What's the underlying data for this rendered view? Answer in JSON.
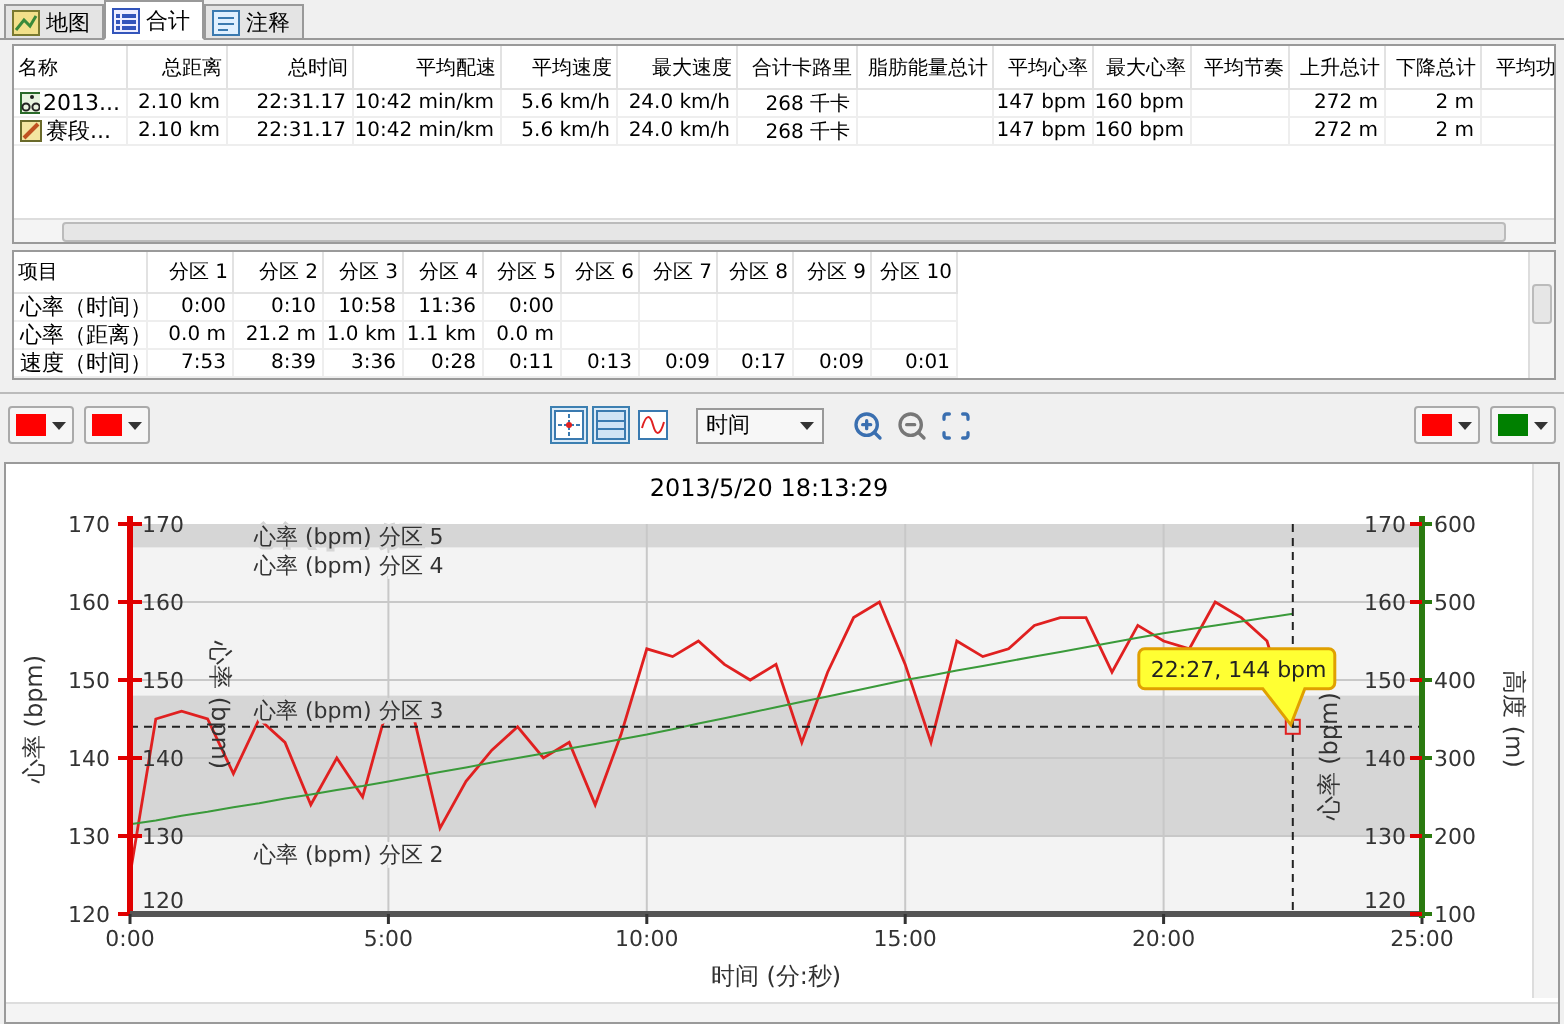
{
  "tabs": [
    {
      "label": "地图",
      "kind": "map",
      "selected": false
    },
    {
      "label": "合计",
      "kind": "grid",
      "selected": true
    },
    {
      "label": "注释",
      "kind": "note",
      "selected": false
    }
  ],
  "summary": {
    "columns": [
      "名称",
      "总距离",
      "总时间",
      "平均配速",
      "平均速度",
      "最大速度",
      "合计卡路里",
      "脂肪能量总计",
      "平均心率",
      "最大心率",
      "平均节奏",
      "上升总计",
      "下降总计",
      "平均功"
    ],
    "rows": [
      {
        "kind": "activity",
        "selected": false,
        "cells": [
          "2013...",
          "2.10 km",
          "22:31.17",
          "10:42 min/km",
          "5.6 km/h",
          "24.0 km/h",
          "268 千卡",
          null,
          "147 bpm",
          "160 bpm",
          null,
          "272 m",
          "2 m",
          null
        ]
      },
      {
        "kind": "segment",
        "selected": false,
        "cells": [
          "赛段...",
          "2.10 km",
          "22:31.17",
          "10:42 min/km",
          "5.6 km/h",
          "24.0 km/h",
          "268 千卡",
          null,
          "147 bpm",
          "160 bpm",
          null,
          "272 m",
          "2 m",
          null
        ]
      }
    ]
  },
  "zones": {
    "columns": [
      "项目",
      "分区 1",
      "分区 2",
      "分区 3",
      "分区 4",
      "分区 5",
      "分区 6",
      "分区 7",
      "分区 8",
      "分区 9",
      "分区 10"
    ],
    "rows": [
      {
        "cells": [
          "心率（时间）",
          "0:00",
          "0:10",
          "10:58",
          "11:36",
          "0:00",
          null,
          null,
          null,
          null,
          null
        ]
      },
      {
        "cells": [
          "心率（距离）",
          "0.0 m",
          "21.2 m",
          "1.0 km",
          "1.1 km",
          "0.0 m",
          null,
          null,
          null,
          null,
          null
        ]
      },
      {
        "cells": [
          "速度（时间）",
          "7:53",
          "8:39",
          "3:36",
          "0:28",
          "0:11",
          "0:13",
          "0:09",
          "0:17",
          "0:09",
          "0:01"
        ]
      }
    ]
  },
  "toolbar": {
    "left_colors": [
      {
        "color": "#ff0000"
      },
      {
        "color": "#ff0000"
      }
    ],
    "view_toggles": [
      {
        "kind": "crosshair",
        "selected": true
      },
      {
        "kind": "bands",
        "selected": true
      },
      {
        "kind": "smooth",
        "selected": false
      }
    ],
    "axis_select": {
      "value": "时间"
    },
    "right_colors": [
      {
        "color": "#ff0000"
      },
      {
        "color": "#008000"
      }
    ]
  },
  "chart": {
    "title": "2013/5/20 18:13:29",
    "zone_labels": [
      "心率 (bpm) 分区 5",
      "心率 (bpm) 分区 4",
      "心率 (bpm) 分区 3",
      "心率 (bpm) 分区 2"
    ],
    "inner_ticks": [
      "170",
      "160",
      "150",
      "140",
      "130",
      "120"
    ],
    "floating_axis_label": "心率 (bpm)",
    "right_axis_label": "心率 (bpm)",
    "right_inner_ticks": [
      "170",
      "160",
      "150",
      "140",
      "130",
      "120"
    ],
    "y2_label": "高度 (m)",
    "tooltip": "22:27, 144 bpm",
    "chart_data": {
      "type": "line",
      "xlabel": "时间 (分:秒)",
      "ylabel": "心率 (bpm)",
      "grid": true,
      "x": [
        0,
        0.5,
        1,
        1.5,
        2,
        2.5,
        3,
        3.5,
        4,
        4.5,
        5,
        5.5,
        6,
        6.5,
        7,
        7.5,
        8,
        8.5,
        9,
        9.5,
        10,
        10.5,
        11,
        11.5,
        12,
        12.5,
        13,
        13.5,
        14,
        14.5,
        15,
        15.5,
        16,
        16.5,
        17,
        17.5,
        18,
        18.5,
        19,
        19.5,
        20,
        20.5,
        21,
        21.5,
        22,
        22.5
      ],
      "series": [
        {
          "color": "#e02020",
          "axis": "y",
          "values": [
            125,
            145,
            146,
            145,
            138,
            145,
            142,
            134,
            140,
            135,
            147,
            145,
            131,
            137,
            141,
            144,
            140,
            142,
            134,
            143,
            154,
            153,
            155,
            152,
            150,
            152,
            142,
            151,
            158,
            160,
            152,
            142,
            155,
            153,
            154,
            157,
            158,
            158,
            151,
            157,
            155,
            154,
            160,
            158,
            155,
            144
          ]
        },
        {
          "color": "#3a9a3a",
          "axis": "y2",
          "values": [
            215,
            220,
            226,
            231,
            237,
            242,
            248,
            253,
            259,
            264,
            270,
            276,
            282,
            288,
            294,
            300,
            306,
            312,
            318,
            324,
            330,
            337,
            344,
            351,
            358,
            365,
            372,
            379,
            386,
            393,
            400,
            406,
            412,
            418,
            424,
            430,
            436,
            442,
            448,
            454,
            460,
            465,
            470,
            475,
            480,
            485
          ]
        }
      ],
      "y2lim": [
        100,
        600
      ],
      "y2ticks": [
        {
          "value": 600,
          "label": "600"
        },
        {
          "value": 500,
          "label": "500"
        },
        {
          "value": 400,
          "label": "400"
        },
        {
          "value": 300,
          "label": "300"
        },
        {
          "value": 200,
          "label": "200"
        },
        {
          "value": 100,
          "label": "100"
        }
      ],
      "xlim": [
        0,
        25
      ],
      "ylim": [
        120,
        170
      ],
      "xticks": [
        {
          "value": 0,
          "label": "0:00"
        },
        {
          "value": 5,
          "label": "5:00"
        },
        {
          "value": 10,
          "label": "10:00"
        },
        {
          "value": 15,
          "label": "15:00"
        },
        {
          "value": 20,
          "label": "20:00"
        },
        {
          "value": 25,
          "label": "25:00"
        }
      ],
      "yticks": [
        {
          "value": 170,
          "label": "170"
        },
        {
          "value": 160,
          "label": "160"
        },
        {
          "value": 150,
          "label": "150"
        },
        {
          "value": 140,
          "label": "140"
        },
        {
          "value": 130,
          "label": "130"
        },
        {
          "value": 120,
          "label": "120"
        }
      ],
      "bands": [
        {
          "axis": "y",
          "from": 167,
          "to": 170
        },
        {
          "axis": "y",
          "from": 130,
          "to": 148
        }
      ],
      "ref_lines": [
        {
          "axis": "x",
          "value": 22.5
        },
        {
          "axis": "y",
          "value": 144
        }
      ]
    }
  }
}
